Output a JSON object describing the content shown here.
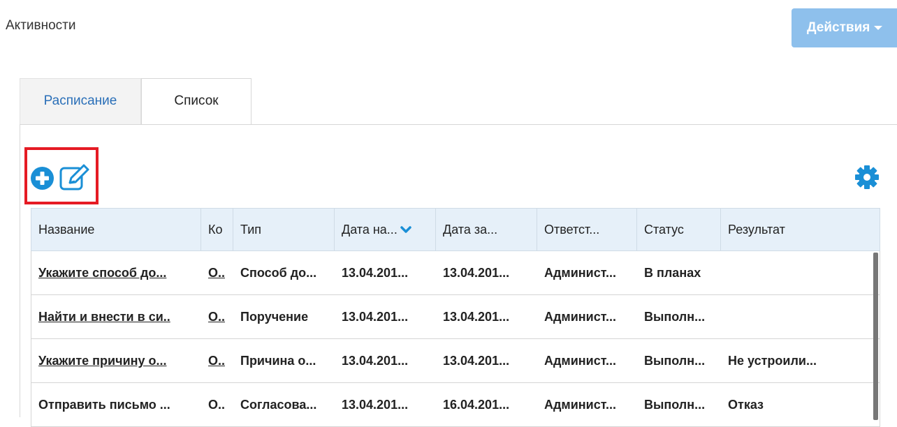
{
  "page_title": "Активности",
  "actions_button": "Действия",
  "tabs": [
    {
      "label": "Расписание",
      "active": false
    },
    {
      "label": "Список",
      "active": true
    }
  ],
  "toolbar": {
    "add_icon": "plus-circle",
    "edit_icon": "edit-square",
    "settings_icon": "gear"
  },
  "table": {
    "columns": [
      "Название",
      "Ко",
      "Тип",
      "Дата на...",
      "Дата за...",
      "Ответст...",
      "Статус",
      "Результат"
    ],
    "sorted_column": "Дата на...",
    "rows": [
      [
        "Укажите способ до...",
        "О..",
        "Способ до...",
        "13.04.201...",
        "13.04.201...",
        "Админист...",
        "В планах",
        ""
      ],
      [
        "Найти и внести в си..",
        "О..",
        "Поручение",
        "13.04.201...",
        "13.04.201...",
        "Админист...",
        "Выполн...",
        ""
      ],
      [
        "Укажите причину о...",
        "О..",
        "Причина о...",
        "13.04.201...",
        "13.04.201...",
        "Админист...",
        "Выполн...",
        "Не устроили..."
      ],
      [
        "Отправить письмо ...",
        "О..",
        "Согласова...",
        "13.04.201...",
        "16.04.201...",
        "Админист...",
        "Выполн...",
        "Отказ"
      ]
    ]
  },
  "colors": {
    "accent": "#1a8fd6",
    "actions_button": "#8ec0ec",
    "header_bg": "#e6f0f9",
    "highlight": "#e51b24"
  }
}
